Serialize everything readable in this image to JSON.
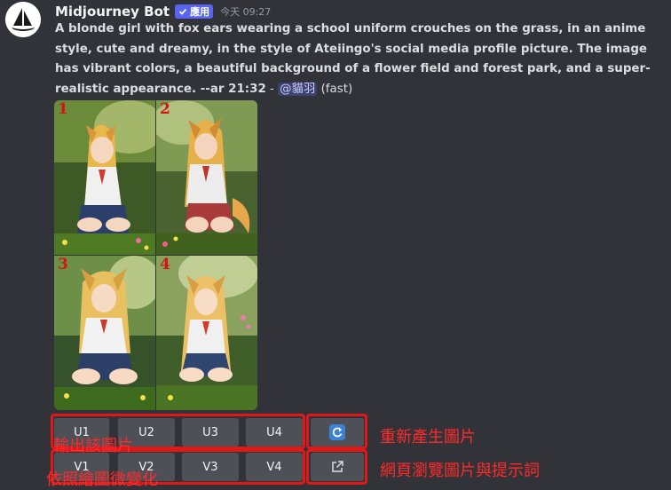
{
  "author": {
    "name": "Midjourney Bot",
    "badge": "應用",
    "timestamp": "今天 09:27"
  },
  "message": {
    "prompt": "A blonde girl with fox ears wearing a school uniform crouches on the grass, in an anime style, cute and dreamy, in the style of Ateiingo's social media profile picture. The image has vibrant colors, a beautiful background of a flower field and forest park, and a super-realistic appearance. --ar 21:32",
    "separator": " - ",
    "mention": "@貓羽",
    "speed": " (fast)"
  },
  "image_grid": {
    "labels": [
      "1",
      "2",
      "3",
      "4"
    ]
  },
  "buttons": {
    "upscale": [
      "U1",
      "U2",
      "U3",
      "U4"
    ],
    "variation": [
      "V1",
      "V2",
      "V3",
      "V4"
    ],
    "reroll_icon": "refresh-icon",
    "web_icon": "external-link-icon"
  },
  "annotations": {
    "upscale": "輸出該圖片",
    "variation": "依照繪圖微變化",
    "reroll": "重新產生圖片",
    "web": "網頁瀏覽圖片與提示詞"
  },
  "colors": {
    "background": "#313338",
    "button": "#4e5058",
    "annotation": "#ff2a2a",
    "badge": "#5865f2"
  }
}
